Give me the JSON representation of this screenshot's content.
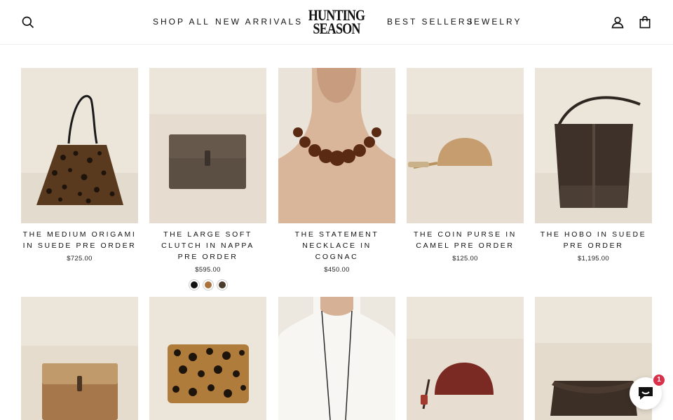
{
  "header": {
    "nav": [
      "SHOP ALL",
      "NEW ARRIVALS",
      "BEST SELLERS",
      "JEWELRY"
    ],
    "logo_line1": "HUNTING",
    "logo_line2": "SEASON",
    "icons": {
      "search": "search-icon",
      "account": "account-icon",
      "cart": "cart-icon"
    }
  },
  "products": [
    {
      "title": "THE MEDIUM ORIGAMI IN SUEDE PRE ORDER",
      "price": "$725.00",
      "image": "leopard-suede-tote"
    },
    {
      "title": "THE LARGE SOFT CLUTCH IN NAPPA PRE ORDER",
      "price": "$595.00",
      "image": "brown-clutch",
      "swatches": [
        "#111111",
        "#a9713c",
        "#4a3a2c"
      ]
    },
    {
      "title": "THE STATEMENT NECKLACE IN COGNAC",
      "price": "$450.00",
      "image": "bead-necklace"
    },
    {
      "title": "THE COIN PURSE IN CAMEL PRE ORDER",
      "price": "$125.00",
      "image": "camel-coin-purse"
    },
    {
      "title": "THE HOBO IN SUEDE PRE ORDER",
      "price": "$1,195.00",
      "image": "suede-hobo-bag"
    },
    {
      "title": "",
      "price": "",
      "image": "tan-clutch"
    },
    {
      "title": "",
      "price": "",
      "image": "leopard-card-case"
    },
    {
      "title": "",
      "price": "",
      "image": "pendant-necklace"
    },
    {
      "title": "",
      "price": "",
      "image": "burgundy-coin-purse"
    },
    {
      "title": "",
      "price": "",
      "image": "suede-envelope-clutch"
    }
  ],
  "chat": {
    "badge_count": "1",
    "icon": "chat-icon"
  },
  "colors": {
    "background": "#ffffff",
    "image_bg": "#e8e1d6",
    "badge": "#d9304b",
    "text": "#111111"
  }
}
